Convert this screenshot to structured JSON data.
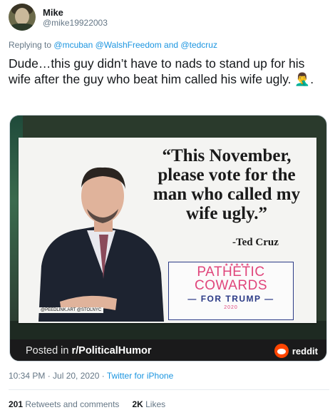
{
  "user": {
    "display_name": "Mike",
    "handle": "@mike19922003"
  },
  "reply": {
    "prefix": "Replying to",
    "mentions": [
      "@mcuban",
      "@WalshFreedom",
      "@tedcruz"
    ],
    "joiner": "and"
  },
  "tweet": {
    "text": "Dude…this guy didn’t have to nads to stand up for his wife after the guy who beat him called his wife ugly. 🤦‍♂️."
  },
  "image": {
    "quote": "“This November, please vote for the man who called my wife ugly.”",
    "attribution": "-Ted Cruz",
    "stars": "★★★★★",
    "badge_line1": "PATHETIC",
    "badge_line2": "COWARDS",
    "badge_for": "— FOR TRUMP —",
    "badge_year": "2020",
    "tags": "@PEEDLINK.ART  @STOLNYC",
    "caption_prefix": "Posted in",
    "caption_subreddit": "r/PoliticalHumor",
    "reddit_label": "reddit"
  },
  "meta": {
    "time": "10:34 PM · Jul 20, 2020 ·",
    "source": "Twitter for iPhone"
  },
  "stats": {
    "retweets": "201",
    "retweets_label": "Retweets and comments",
    "likes": "2K",
    "likes_label": "Likes"
  },
  "colors": {
    "link": "#1b95e0",
    "muted": "#657786",
    "reddit": "#ff4500",
    "badge_pink": "#e0457b",
    "badge_navy": "#2b3a86"
  }
}
